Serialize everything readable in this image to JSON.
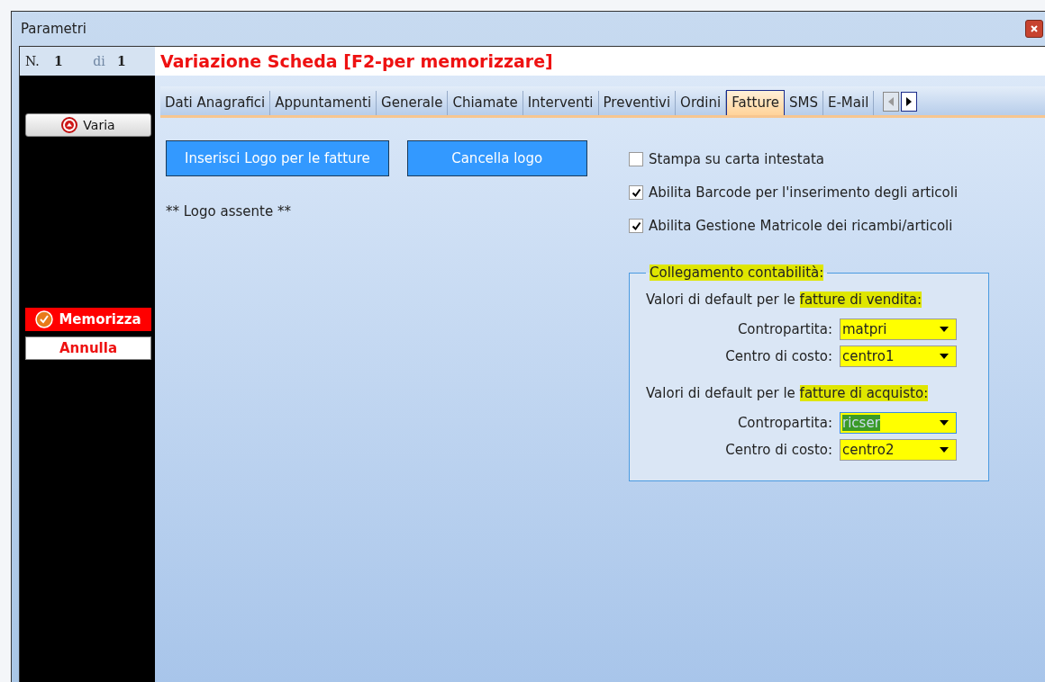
{
  "window": {
    "title": "Parametri"
  },
  "record": {
    "prefix": "N.",
    "current": "1",
    "separator": "di",
    "total": "1"
  },
  "heading": "Variazione Scheda [F2-per memorizzare]",
  "sidebar": {
    "buttons": [
      {
        "kind": "plain",
        "label": "Varia"
      },
      {
        "kind": "primary",
        "label": "Memorizza"
      },
      {
        "kind": "cancel",
        "label": "Annulla"
      }
    ]
  },
  "tabs": [
    {
      "label": "Dati Anagrafici",
      "selected": false
    },
    {
      "label": "Appuntamenti",
      "selected": false
    },
    {
      "label": "Generale",
      "selected": false
    },
    {
      "label": "Chiamate",
      "selected": false
    },
    {
      "label": "Interventi",
      "selected": false
    },
    {
      "label": "Preventivi",
      "selected": false
    },
    {
      "label": "Ordini",
      "selected": false
    },
    {
      "label": "Fatture",
      "selected": true
    },
    {
      "label": "SMS",
      "selected": false
    },
    {
      "label": "E-Mail",
      "selected": false
    }
  ],
  "logo": {
    "buttons": [
      "Inserisci Logo per le fatture",
      "Cancella logo"
    ],
    "status": "** Logo assente **"
  },
  "options": [
    {
      "label": "Stampa su carta intestata",
      "checked": false
    },
    {
      "label": "Abilita Barcode per l'inserimento degli articoli",
      "checked": true
    },
    {
      "label": "Abilita Gestione Matricole dei ricambi/articoli",
      "checked": true
    }
  ],
  "accounting": {
    "title": "Collegamento contabilità:",
    "title_highlighted": true,
    "groups": [
      {
        "text": "Valori di default per le",
        "highlight": "fatture di vendita:",
        "fields": [
          {
            "label": "Contropartita:",
            "value": "matpri",
            "highlighted": true,
            "value_selected": false
          },
          {
            "label": "Centro di costo:",
            "value": "centro1",
            "highlighted": true,
            "value_selected": false
          }
        ]
      },
      {
        "text": "Valori di default per le",
        "highlight": "fatture di acquisto:",
        "fields": [
          {
            "label": "Contropartita:",
            "value": "ricser",
            "highlighted": true,
            "value_selected": true
          },
          {
            "label": "Centro di costo:",
            "value": "centro2",
            "highlighted": true,
            "value_selected": false
          }
        ]
      }
    ]
  }
}
